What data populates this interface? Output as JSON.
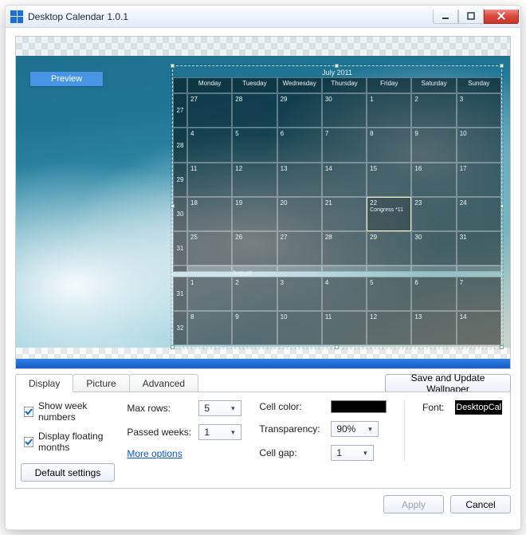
{
  "window": {
    "title": "Desktop Calendar 1.0.1"
  },
  "preview": {
    "badge": "Preview"
  },
  "calendar": {
    "title_a": "July 2011",
    "weekdays": [
      "Monday",
      "Tuesday",
      "Wednesday",
      "Thursday",
      "Friday",
      "Saturday",
      "Sunday"
    ],
    "month_a_weeks": [
      {
        "wk": "27",
        "days": [
          "27",
          "28",
          "29",
          "30",
          "1",
          "2",
          "3"
        ]
      },
      {
        "wk": "28",
        "days": [
          "4",
          "5",
          "6",
          "7",
          "8",
          "9",
          "10"
        ]
      },
      {
        "wk": "29",
        "days": [
          "11",
          "12",
          "13",
          "14",
          "15",
          "16",
          "17"
        ]
      },
      {
        "wk": "30",
        "days": [
          "18",
          "19",
          "20",
          "21",
          "22",
          "23",
          "24"
        ]
      },
      {
        "wk": "31",
        "days": [
          "25",
          "26",
          "27",
          "28",
          "29",
          "30",
          "31"
        ]
      }
    ],
    "today": {
      "row": 3,
      "col": 4,
      "label": "Congress *11"
    },
    "title_b": "August",
    "month_b_weeks": [
      {
        "wk": "31",
        "days": [
          "1",
          "2",
          "3",
          "4",
          "5",
          "6",
          "7"
        ]
      },
      {
        "wk": "32",
        "days": [
          "8",
          "9",
          "10",
          "11",
          "12",
          "13",
          "14"
        ]
      }
    ]
  },
  "toolbar": {
    "save_label": "Save and Update Wallpaper"
  },
  "tabs": {
    "display": "Display",
    "picture": "Picture",
    "advanced": "Advanced"
  },
  "display": {
    "show_week_numbers": "Show week numbers",
    "display_floating_months": "Display floating months",
    "default_settings": "Default settings",
    "max_rows_label": "Max rows:",
    "max_rows_value": "5",
    "passed_weeks_label": "Passed weeks:",
    "passed_weeks_value": "1",
    "more_options": "More options",
    "cell_color_label": "Cell color:",
    "cell_color_value": "#000000",
    "transparency_label": "Transparency:",
    "transparency_value": "90%",
    "cell_gap_label": "Cell gap:",
    "cell_gap_value": "1",
    "font_label": "Font:",
    "font_value": "DesktopCal"
  },
  "footer": {
    "apply": "Apply",
    "cancel": "Cancel"
  }
}
